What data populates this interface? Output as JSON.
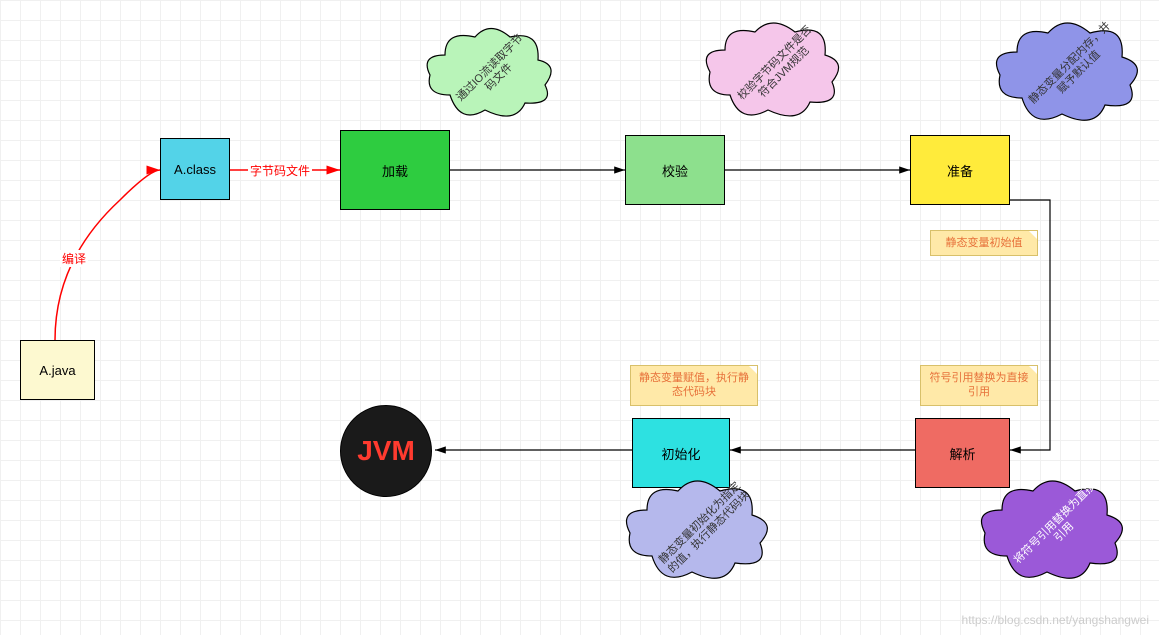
{
  "nodes": {
    "ajava": {
      "label": "A.java"
    },
    "aclass": {
      "label": "A.class"
    },
    "loading": {
      "label": "加载"
    },
    "verify": {
      "label": "校验"
    },
    "prepare": {
      "label": "准备"
    },
    "resolve": {
      "label": "解析"
    },
    "init": {
      "label": "初始化"
    },
    "jvm": {
      "label": "JVM"
    }
  },
  "edges": {
    "compile": {
      "label": "编译"
    },
    "bytecode": {
      "label": "字节码文件"
    }
  },
  "clouds": {
    "c1": "通过IO流读取字节码文件",
    "c2": "校验字节码文件是否符合JVM规范",
    "c3": "静态变量分配内存，并赋予默认值",
    "c4": "将符号引用替换为直接引用",
    "c5": "静态变量初始化为指定的值，执行静态代码块"
  },
  "notes": {
    "n1": "静态变量初始值",
    "n2": "符号引用替换为直接引用",
    "n3": "静态变量赋值，执行静态代码块"
  },
  "watermark": "https://blog.csdn.net/yangshangwei"
}
